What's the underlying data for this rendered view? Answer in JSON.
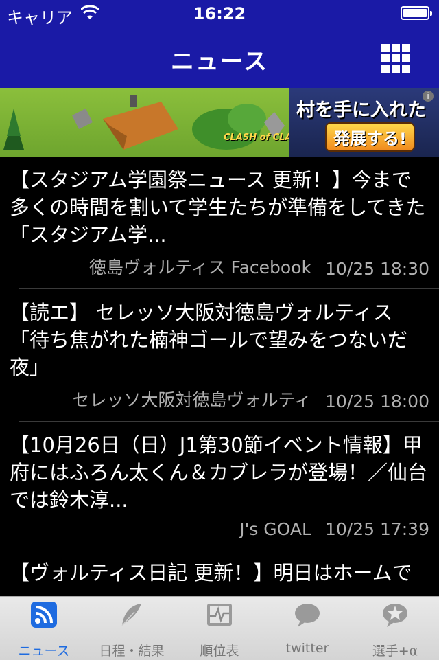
{
  "status_bar": {
    "carrier": "キャリア",
    "time": "16:22"
  },
  "nav": {
    "title": "ニュース",
    "menu_icon": "grid-icon"
  },
  "banner": {
    "ad_line1": "村を手に入れた",
    "ad_line2": "発展する!",
    "game_logo": "CLASH of CLANS",
    "info": "i"
  },
  "news": [
    {
      "text": "【スタジアム学園祭ニュース 更新！】今まで多くの時間を割いて学生たちが準備をしてきた「スタジアム学...",
      "source": "徳島ヴォルティス Facebook",
      "date": "10/25 18:30"
    },
    {
      "text": "【読エ】 セレッソ大阪対徳島ヴォルティス「待ち焦がれた楠神ゴールで望みをつないだ夜」",
      "source": "セレッソ大阪対徳島ヴォルティ",
      "date": "10/25 18:00"
    },
    {
      "text": "【10月26日（日）J1第30節イベント情報】甲府にはふろん太くん＆カブレラが登場！／仙台では鈴木淳...",
      "source": "J's GOAL",
      "date": "10/25 17:39"
    },
    {
      "text": "【ヴォルティス日記 更新！】明日はホームでの名古屋グランパス戦。前",
      "source": "",
      "date": ""
    }
  ],
  "tabs": [
    {
      "label": "ニュース",
      "icon": "rss-icon",
      "active": true
    },
    {
      "label": "日程・結果",
      "icon": "feather-icon",
      "active": false
    },
    {
      "label": "順位表",
      "icon": "chart-icon",
      "active": false
    },
    {
      "label": "twitter",
      "icon": "speech-bubble-icon",
      "active": false
    },
    {
      "label": "選手+α",
      "icon": "star-bubble-icon",
      "active": false
    }
  ],
  "colors": {
    "bar": "#1a1aa6",
    "accent": "#1e6be0"
  }
}
